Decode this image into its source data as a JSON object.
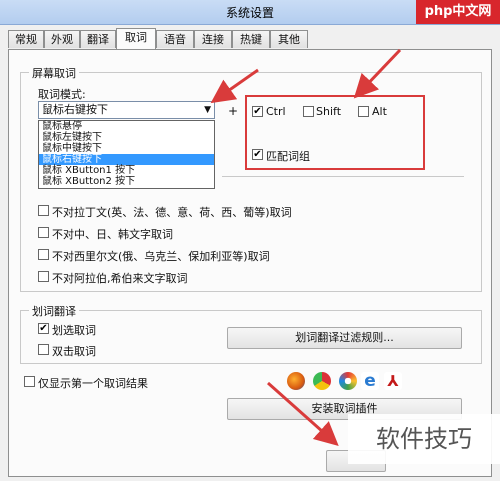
{
  "window": {
    "title": "系统设置"
  },
  "watermark_top": "php中文网",
  "watermark_bottom": "软件技巧",
  "tabs": [
    {
      "label": "常规"
    },
    {
      "label": "外观"
    },
    {
      "label": "翻译"
    },
    {
      "label": "取词"
    },
    {
      "label": "语音"
    },
    {
      "label": "连接"
    },
    {
      "label": "热键"
    },
    {
      "label": "其他"
    }
  ],
  "screen": {
    "group_label": "屏幕取词",
    "mode_label": "取词模式:",
    "mode_value": "鼠标右键按下",
    "dropdown_options": [
      "鼠标悬停",
      "鼠标左键按下",
      "鼠标中键按下",
      "鼠标右键按下",
      "鼠标 XButton1 按下",
      "鼠标 XButton2 按下"
    ],
    "selected_index": 3,
    "plus": "+",
    "mods": [
      {
        "label": "Ctrl",
        "checked": true
      },
      {
        "label": "Shift",
        "checked": false
      },
      {
        "label": "Alt",
        "checked": false
      }
    ],
    "match_label": "匹配词组",
    "lang_opts": [
      "不对拉丁文(英、法、德、意、荷、西、葡等)取词",
      "不对中、日、韩文字取词",
      "不对西里尔文(俄、乌克兰、保加利亚等)取词",
      "不对阿拉伯,希伯来文字取词"
    ]
  },
  "select_translate": {
    "group_label": "划词翻译",
    "opt1": "划选取词",
    "opt2": "双击取词",
    "filter_button": "划词翻译过滤规则..."
  },
  "first_only": "仅显示第一个取词结果",
  "install_button": "安装取词插件",
  "colors": {
    "red_annotation": "#d93b3b",
    "selection": "#3399ff"
  }
}
